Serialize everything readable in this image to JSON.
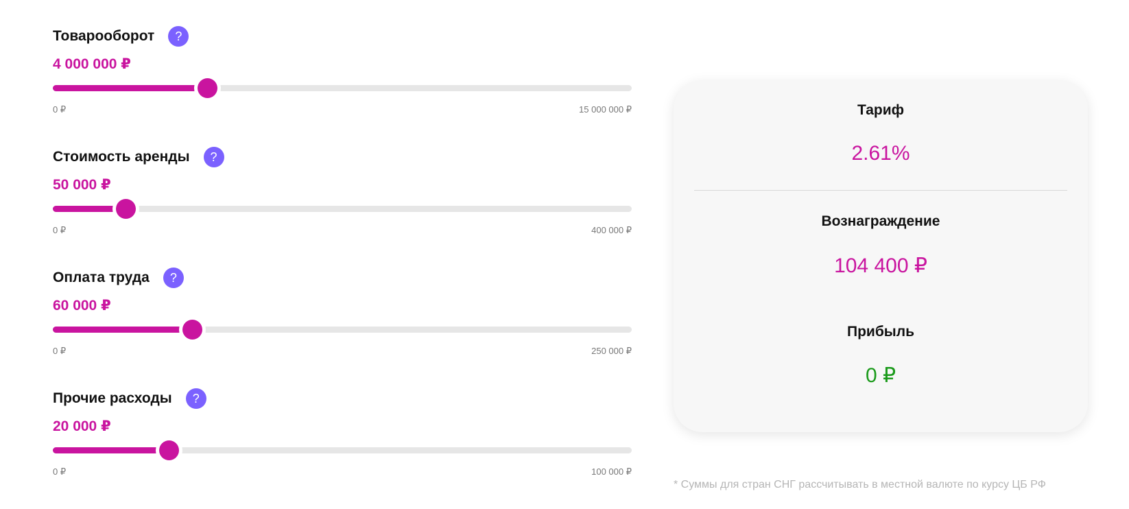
{
  "sliders": [
    {
      "title": "Товарооборот",
      "value": "4 000 000 ₽",
      "min": "0 ₽",
      "max": "15 000 000 ₽",
      "fraction": 0.2667
    },
    {
      "title": "Стоимость аренды",
      "value": "50 000 ₽",
      "min": "0 ₽",
      "max": "400 000 ₽",
      "fraction": 0.125
    },
    {
      "title": "Оплата труда",
      "value": "60 000 ₽",
      "min": "0 ₽",
      "max": "250 000 ₽",
      "fraction": 0.24
    },
    {
      "title": "Прочие расходы",
      "value": "20 000 ₽",
      "min": "0 ₽",
      "max": "100 000 ₽",
      "fraction": 0.2
    }
  ],
  "help_icon": "?",
  "result": {
    "tariff_label": "Тариф",
    "tariff_value": "2.61%",
    "reward_label": "Вознаграждение",
    "reward_value": "104 400 ₽",
    "profit_label": "Прибыль",
    "profit_value": "0 ₽"
  },
  "footnote": "* Суммы для стран СНГ рассчитывать в местной валюте по курсу ЦБ РФ",
  "colors": {
    "accent": "#c9149f",
    "help": "#7b61ff",
    "profit": "#1a9a1a",
    "track": "#e6e6e6"
  }
}
